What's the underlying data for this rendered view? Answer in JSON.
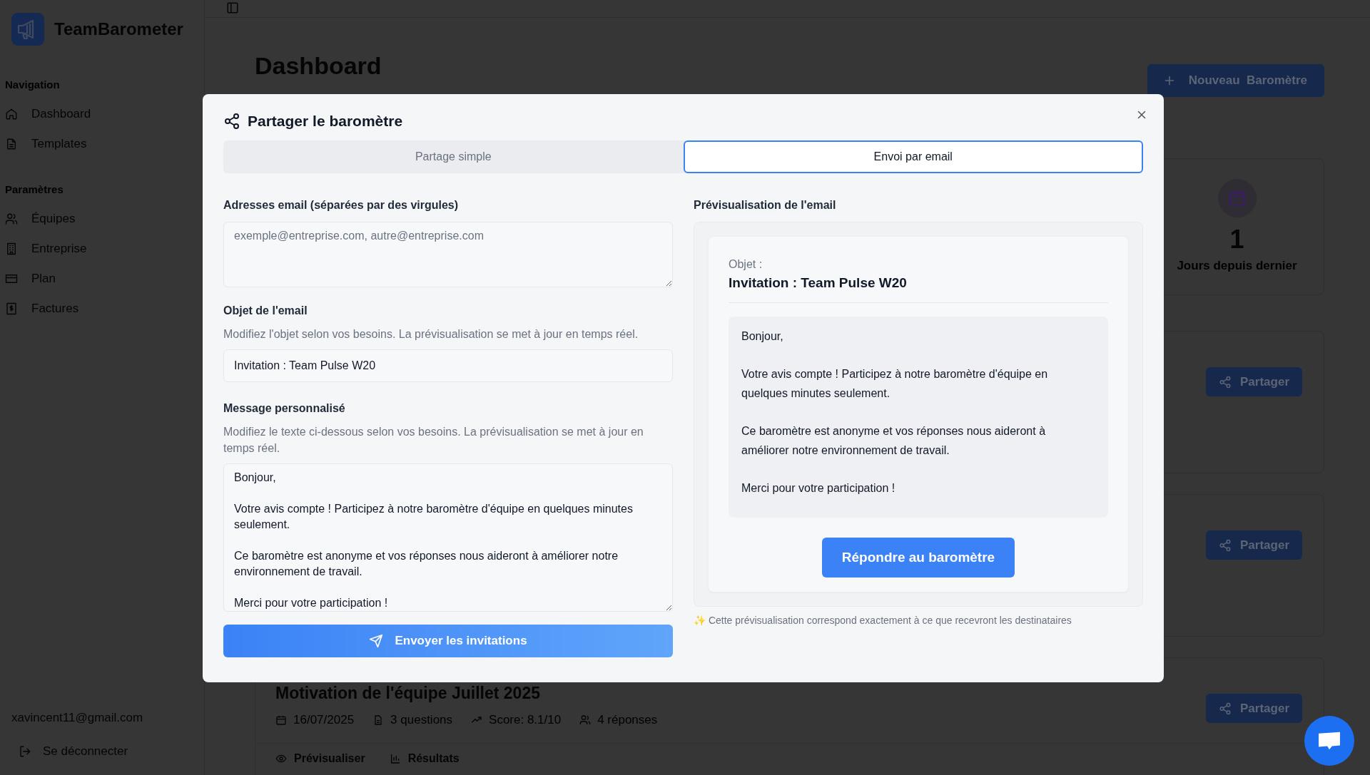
{
  "sidebar": {
    "app_name": "TeamBarometer",
    "sections": [
      {
        "heading": "Navigation",
        "items": [
          {
            "label": "Dashboard"
          },
          {
            "label": "Templates"
          }
        ]
      },
      {
        "heading": "Paramètres",
        "items": [
          {
            "label": "Équipes"
          },
          {
            "label": "Entreprise"
          },
          {
            "label": "Plan"
          },
          {
            "label": "Factures"
          }
        ]
      }
    ],
    "user_email": "xavincent11@gmail.com",
    "logout": "Se déconnecter"
  },
  "page": {
    "title": "Dashboard",
    "new_button": "Nouveau  Baromètre",
    "stat": {
      "value": "1",
      "label": "Jours depuis dernier"
    },
    "barometers": [
      {
        "share": "Partager"
      },
      {
        "share": "Partager"
      },
      {
        "title": "Motivation de l'équipe Juillet 2025",
        "date": "16/07/2025",
        "questions": "3 questions",
        "score": "Score: 8.1/10",
        "responses": "4 réponses",
        "actions": [
          "Prévisualiser",
          "Résultats"
        ],
        "share": "Partager"
      }
    ]
  },
  "modal": {
    "title": "Partager le baromètre",
    "tabs": [
      {
        "label": "Partage simple",
        "selected": false
      },
      {
        "label": "Envoi par email",
        "selected": true
      }
    ],
    "emails": {
      "label": "Adresses email (séparées par des virgules)",
      "placeholder": "exemple@entreprise.com, autre@entreprise.com"
    },
    "subject": {
      "label": "Objet de l'email",
      "hint": "Modifiez l'objet selon vos besoins. La prévisualisation se met à jour en temps réel.",
      "value": "Invitation : Team Pulse W20"
    },
    "message": {
      "label": "Message personnalisé",
      "hint": "Modifiez le texte ci-dessous selon vos besoins. La prévisualisation se met à jour en temps réel.",
      "value": "Bonjour,\n\nVotre avis compte ! Participez à notre baromètre d'équipe en quelques minutes seulement.\n\nCe baromètre est anonyme et vos réponses nous aideront à améliorer notre environnement de travail.\n\nMerci pour votre participation !"
    },
    "send_button": "Envoyer les invitations",
    "preview": {
      "heading": "Prévisualisation de l'email",
      "subject_label": "Objet :",
      "subject": "Invitation : Team Pulse W20",
      "body": [
        "Bonjour,",
        "Votre avis compte ! Participez à notre baromètre d'équipe en quelques minutes seulement.",
        "Ce baromètre est anonyme et vos réponses nous aideront à améliorer notre environnement de travail.",
        "Merci pour votre participation !"
      ],
      "cta": "Répondre au baromètre",
      "note": "✨ Cette prévisualisation correspond exactement à ce que recevront les destinataires"
    }
  }
}
